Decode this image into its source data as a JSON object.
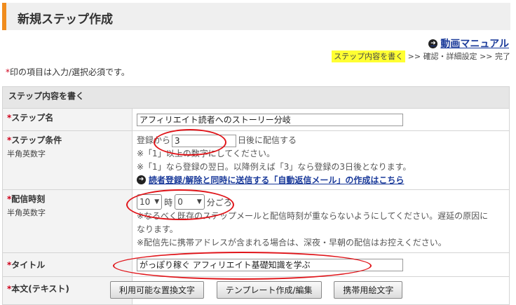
{
  "header": {
    "title": "新規ステップ作成"
  },
  "manual_link": "動画マニュアル",
  "steps": {
    "current": "ステップ内容を書く",
    "sep1": ">>",
    "confirm": "確認・詳細設定",
    "sep2": ">>",
    "done": "完了"
  },
  "required_note": {
    "mark": "*",
    "text": "印の項目は入力/選択必須です。"
  },
  "section_title": "ステップ内容を書く",
  "fields": {
    "step_name": {
      "mark": "*",
      "label": "ステップ名",
      "value": "アフィリエイト読者へのストーリー分岐"
    },
    "step_condition": {
      "mark": "*",
      "label": "ステップ条件",
      "sub": "半角英数字",
      "prefix": "登録から",
      "value": "3",
      "suffix": "日後に配信する",
      "note1": "※「1」以上の数字にしてください。",
      "note2": "※「1」なら登録の翌日。以降例えば「3」なら登録の3日後となります。",
      "link": "読者登録/解除と同時に送信する「自動返信メール」の作成はこちら"
    },
    "delivery_time": {
      "mark": "*",
      "label": "配信時刻",
      "sub": "半角英数字",
      "hour": "10",
      "hour_unit": "時",
      "minute": "0",
      "minute_unit": "分ごろ",
      "note1": "※なるべく既存のステップメールと配信時刻が重ならないようにしてください。遅延の原因に",
      "note1b": "なります。",
      "note2": "※配信先に携帯アドレスが含まれる場合は、深夜・早朝の配信はお控えください。"
    },
    "title": {
      "mark": "*",
      "label": "タイトル",
      "value": "がっぽり稼ぐ アフィリエイト基礎知識を学ぶ"
    },
    "body": {
      "mark": "*",
      "label": "本文(テキスト)",
      "btn_replace": "利用可能な置換文字",
      "btn_template": "テンプレート作成/編集",
      "btn_emoji": "携帯用絵文字"
    }
  },
  "colors": {
    "accent": "#f08c1e",
    "highlight": "#ffff33",
    "required": "#d0021b",
    "annotation": "#e0151a",
    "link": "#1a3a9a"
  }
}
